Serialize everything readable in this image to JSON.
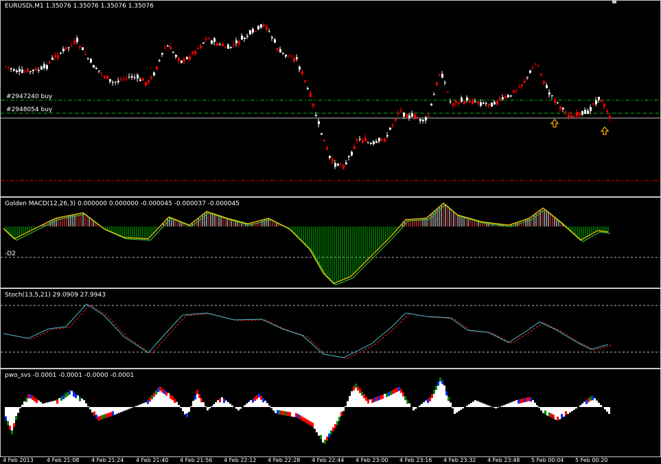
{
  "main": {
    "title": "EURUSDi,M1  1.35076 1.35076 1.35076 1.35076",
    "orders": [
      {
        "label": "#2947240 buy"
      },
      {
        "label": "#2948054 buy"
      }
    ],
    "colors": {
      "bull": "#ff0000",
      "bear": "#ffffff",
      "order_line": "#00c000",
      "stop_line": "#ff0000",
      "grid": "#c0c0c0",
      "arrow": "#ffb000"
    }
  },
  "macd": {
    "title": "Golden MACD(12,26,3) 0.000000 0.000000 -0.000045 -0.000037 -0.000045",
    "level_label": "-D2",
    "colors": {
      "line_main": "#ffd000",
      "line_signal": "#30c030",
      "hist_pos": "#ffffff",
      "hist_neg": "#00c000"
    }
  },
  "stoch": {
    "title": "Stoch(13,5,21) 29.0909 27.9943",
    "colors": {
      "main": "#40c0d0",
      "signal": "#ff2020"
    }
  },
  "pwo": {
    "title": "pwo_svs -0.0001 -0.0001 -0.0000 -0.0001",
    "colors": {
      "white": "#ffffff",
      "red": "#ff0000",
      "blue": "#0030ff",
      "green": "#008000"
    }
  },
  "time_axis": {
    "labels": [
      "4 Feb 2013",
      "4 Feb 21:08",
      "4 Feb 21:24",
      "4 Feb 21:40",
      "4 Feb 21:56",
      "4 Feb 22:12",
      "4 Feb 22:28",
      "4 Feb 22:44",
      "4 Feb 23:00",
      "4 Feb 23:16",
      "4 Feb 23:32",
      "4 Feb 23:48",
      "5 Feb 00:04",
      "5 Feb 00:20"
    ]
  }
}
